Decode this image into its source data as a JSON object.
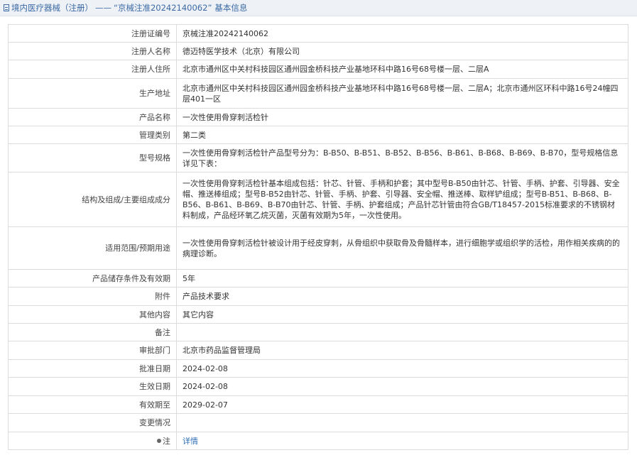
{
  "header": {
    "category": "境内医疗器械（注册）",
    "separator": "——",
    "record_title": "“京械注准20242140062”",
    "suffix": "基本信息"
  },
  "rows": [
    {
      "label": "注册证编号",
      "value": "京械注准20242140062"
    },
    {
      "label": "注册人名称",
      "value": "德迈特医学技术（北京）有限公司"
    },
    {
      "label": "注册人住所",
      "value": "北京市通州区中关村科技园区通州园金桥科技产业基地环科中路16号68号楼一层、二层A"
    },
    {
      "label": "生产地址",
      "value": "北京市通州区中关村科技园区通州园金桥科技产业基地环科中路16号68号楼一层、二层A；北京市通州区环科中路16号24幢四层401一区"
    },
    {
      "label": "产品名称",
      "value": "一次性使用骨穿刺活检针"
    },
    {
      "label": "管理类别",
      "value": "第二类"
    },
    {
      "label": "型号规格",
      "value": "一次性使用骨穿刺活检针产品型号分为：B-B50、B-B51、B-B52、B-B56、B-B61、B-B68、B-B69、B-B70，型号规格信息详见下表："
    },
    {
      "label": "结构及组成/主要组成成分",
      "value": "一次性使用骨穿刺活检针基本组成包括：针芯、针管、手柄和护套；其中型号B-B50由针芯、针管、手柄、护套、引导器、安全帽、推送棒组成；型号B-B52由针芯、针管、手柄、护套、引导器、安全帽、推送棒、取样铲组成；型号B-B51、B-B68、B-B56、B-B61、B-B69、B-B70由针芯、针管、手柄、护套组成；产品针芯针管由符合GB/T18457-2015标准要求的不锈钢材料制成，产品经环氧乙烷灭菌，灭菌有效期为5年，一次性使用。"
    },
    {
      "label": "适用范围/预期用途",
      "value": "一次性使用骨穿刺活检针被设计用于经皮穿刺，从骨组织中获取骨及骨髓样本，进行细胞学或组织学的活检，用作相关疾病的的病理诊断。"
    },
    {
      "label": "产品储存条件及有效期",
      "value": "5年"
    },
    {
      "label": "附件",
      "value": "产品技术要求"
    },
    {
      "label": "其他内容",
      "value": "其它内容"
    },
    {
      "label": "备注",
      "value": ""
    },
    {
      "label": "审批部门",
      "value": "北京市药品监督管理局"
    },
    {
      "label": "批准日期",
      "value": "2024-02-08"
    },
    {
      "label": "生效日期",
      "value": "2024-02-08"
    },
    {
      "label": "有效期至",
      "value": "2029-02-07"
    },
    {
      "label": "变更情况",
      "value": ""
    }
  ],
  "note_row": {
    "label": "注",
    "link_text": "详情",
    "icon": "pin-icon"
  },
  "colors": {
    "link": "#2f6fb7",
    "title": "#3b6aa6",
    "border": "#dcdcdc",
    "header_bg": "#eef1f5"
  }
}
